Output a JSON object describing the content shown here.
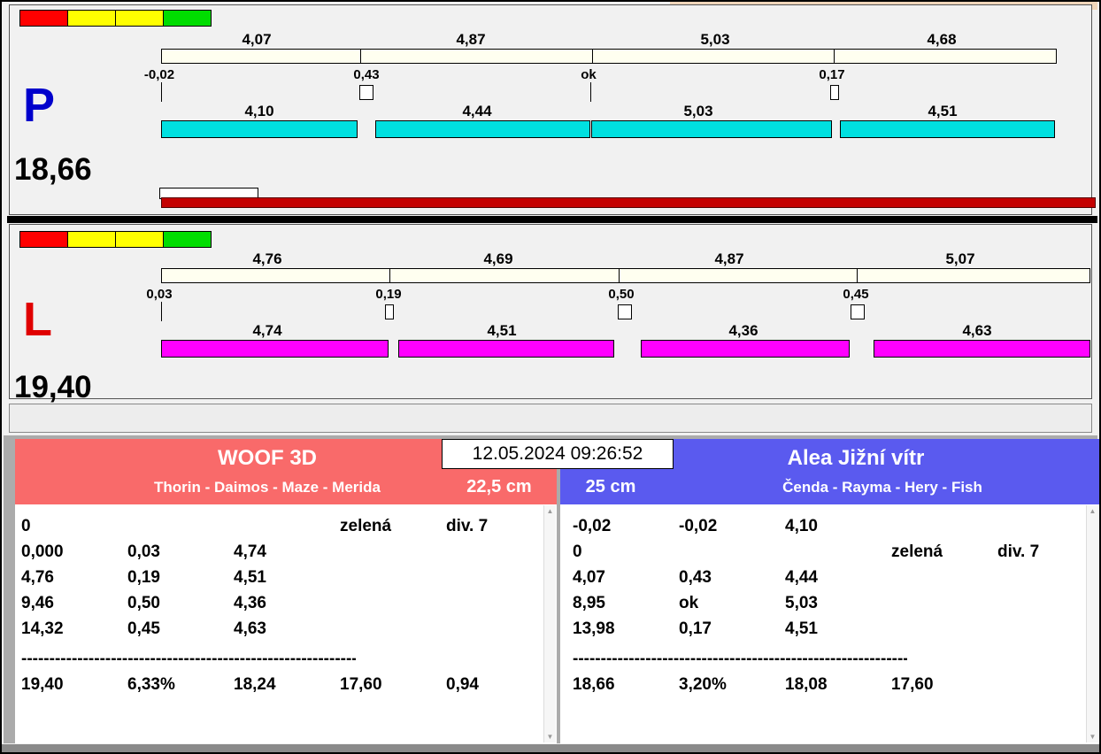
{
  "window": {
    "datetime": "12.05.2024 09:26:52"
  },
  "lane_p": {
    "label": "P",
    "total": "18,66",
    "front_splits": [
      "4,07",
      "4,87",
      "5,03",
      "4,68"
    ],
    "change_values": [
      "-0,02",
      "0,43",
      "ok",
      "0,17"
    ],
    "back_splits": [
      "4,10",
      "4,44",
      "5,03",
      "4,51"
    ]
  },
  "lane_l": {
    "label": "L",
    "total": "19,40",
    "front_splits": [
      "4,76",
      "4,69",
      "4,87",
      "5,07"
    ],
    "change_values": [
      "0,03",
      "0,19",
      "0,50",
      "0,45"
    ],
    "back_splits": [
      "4,74",
      "4,51",
      "4,36",
      "4,63"
    ]
  },
  "left_panel": {
    "team": "WOOF 3D",
    "dogs": "Thorin - Daimos - Maze - Merida",
    "jump_height": "22,5 cm",
    "rows": [
      [
        "0",
        "",
        "",
        "zelená",
        "div. 7"
      ],
      [
        "0,000",
        "0,03",
        "4,74",
        "",
        ""
      ],
      [
        "4,76",
        "0,19",
        "4,51",
        "",
        ""
      ],
      [
        "9,46",
        "0,50",
        "4,36",
        "",
        ""
      ],
      [
        "14,32",
        "0,45",
        "4,63",
        "",
        ""
      ]
    ],
    "separator": "------------------------------------------------------------",
    "summary": [
      "19,40",
      "6,33%",
      "18,24",
      "17,60",
      "0,94"
    ]
  },
  "right_panel": {
    "team": "Alea Jižní vítr",
    "dogs": "Čenda - Rayma - Hery - Fish",
    "jump_height": "25 cm",
    "rows": [
      [
        "-0,02",
        "-0,02",
        "4,10",
        "",
        ""
      ],
      [
        "0",
        "",
        "",
        "zelená",
        "div. 7"
      ],
      [
        "4,07",
        "0,43",
        "4,44",
        "",
        ""
      ],
      [
        "8,95",
        "ok",
        "5,03",
        "",
        ""
      ],
      [
        "13,98",
        "0,17",
        "4,51",
        "",
        ""
      ]
    ],
    "separator": "------------------------------------------------------------",
    "summary": [
      "18,66",
      "3,20%",
      "18,08",
      "17,60",
      ""
    ]
  },
  "icons": {
    "scroll_up_icon": "▲",
    "scroll_down_icon": "▼"
  },
  "colors": {
    "p_bar": "#00e0e0",
    "l_bar": "#ff00ff",
    "p_letter": "#0000cc",
    "l_letter": "#e00000",
    "left_header": "#f96a6a",
    "right_header": "#5a5aef",
    "progress_red": "#c40000",
    "traffic_red": "#ff0000",
    "traffic_yellow": "#ffff00",
    "traffic_green": "#00dd00"
  }
}
